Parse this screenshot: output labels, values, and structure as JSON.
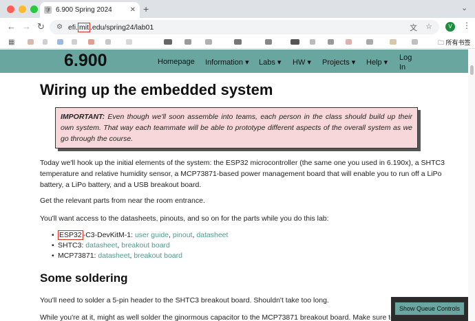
{
  "browser": {
    "tab_title": "6.900 Spring 2024",
    "tab_favicon": "🛡",
    "tab_close": "✕",
    "new_tab": "+",
    "tab_menu": "⌄",
    "url_prefix": "efi.",
    "url_highlight": "mit",
    "url_suffix": ".edu/spring24/lab01",
    "avatar_initial": "V",
    "bookmarks_folder": "所有书签"
  },
  "site": {
    "brand": "6.900",
    "nav": {
      "homepage": "Homepage",
      "information": "Information ▾",
      "labs": "Labs ▾",
      "hw": "HW ▾",
      "projects": "Projects ▾",
      "help": "Help ▾",
      "login": "Log In"
    }
  },
  "content": {
    "title": "Wiring up the embedded system",
    "important_label": "IMPORTANT:",
    "important_text": " Even though we'll soon assemble into teams, each person in the class should build up their own system. That way each teammate will be able to prototype different aspects of the overall system as we go through the course.",
    "intro": "Today we'll hook up the initial elements of the system: the ESP32 microcontroller (the same one you used in 6.190x), a SHTC3 temperature and relative humidity sensor, a MCP73871-based power management board that will enable you to run off a LiPo battery, a LiPo battery, and a USB breakout board.",
    "get_parts": "Get the relevant parts from near the room entrance.",
    "access": "You'll want access to the datasheets, pinouts, and so on for the parts while you do this lab:",
    "parts": {
      "esp_highlight": "ESP32",
      "esp_rest": "-C3-DevKitM-1: ",
      "esp_links": [
        "user guide",
        "pinout",
        "datasheet"
      ],
      "shtc_label": "SHTC3: ",
      "shtc_links": [
        "datasheet",
        "breakout board"
      ],
      "mcp_label": "MCP73871: ",
      "mcp_links": [
        "datasheet",
        "breakout board"
      ]
    },
    "soldering_title": "Some soldering",
    "solder_p1": "You'll need to solder a 5-pin header to the SHTC3 breakout board. Shouldn't take too long.",
    "solder_p2": "While you're at it, might as well solder the ginormous capacitor to the MCP73871 breakout board. Make sure to g"
  },
  "queue_button": "Show Queue Controls",
  "colors": {
    "nav_bg": "#6aa6a0",
    "link": "#4d9a8e",
    "important_bg": "#f8d7da",
    "highlight_box": "#d93025"
  }
}
